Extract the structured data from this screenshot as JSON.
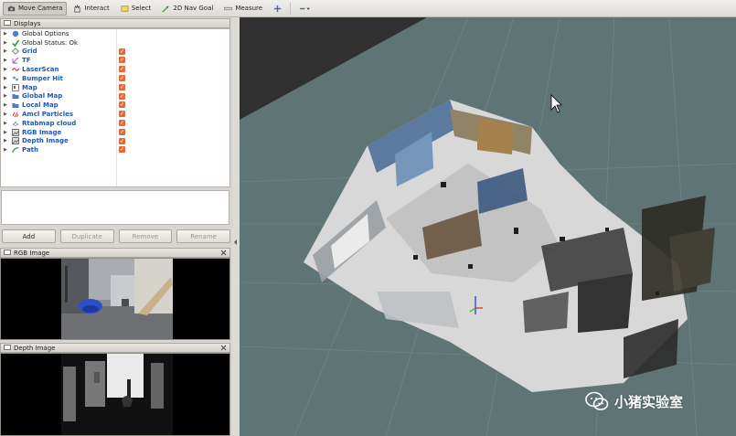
{
  "toolbar": {
    "tools": [
      {
        "label": "Move Camera",
        "active": true,
        "icon": "camera-icon"
      },
      {
        "label": "Interact",
        "active": false,
        "icon": "hand-icon"
      },
      {
        "label": "Select",
        "active": false,
        "icon": "select-icon"
      },
      {
        "label": "2D Nav Goal",
        "active": false,
        "icon": "nav-goal-icon"
      },
      {
        "label": "Measure",
        "active": false,
        "icon": "ruler-icon"
      }
    ],
    "add_icon": "plus-icon",
    "minus_icon": "minus-dropdown-icon"
  },
  "displays_panel": {
    "title": "Displays",
    "items": [
      {
        "label": "Global Options",
        "plain": true,
        "checked": false,
        "icon": "globe-icon",
        "icon_color": "#4a7fd0"
      },
      {
        "label": "Global Status: Ok",
        "plain": true,
        "checked": false,
        "icon": "check-icon",
        "icon_color": "#2c8c2c"
      },
      {
        "label": "Grid",
        "plain": false,
        "checked": true,
        "icon": "grid-icon",
        "icon_color": "#777777"
      },
      {
        "label": "TF",
        "plain": false,
        "checked": true,
        "icon": "tf-icon",
        "icon_color": "#8e5fb8"
      },
      {
        "label": "LaserScan",
        "plain": false,
        "checked": true,
        "icon": "laser-icon",
        "icon_color": "#d03030"
      },
      {
        "label": "Bumper Hit",
        "plain": false,
        "checked": true,
        "icon": "bumper-icon",
        "icon_color": "#5a8fd0"
      },
      {
        "label": "Map",
        "plain": false,
        "checked": true,
        "icon": "map-icon",
        "icon_color": "#666666"
      },
      {
        "label": "Global Map",
        "plain": false,
        "checked": true,
        "icon": "folder-icon",
        "icon_color": "#4b7fc7"
      },
      {
        "label": "Local Map",
        "plain": false,
        "checked": true,
        "icon": "folder-icon",
        "icon_color": "#4b7fc7"
      },
      {
        "label": "Amcl Particles",
        "plain": false,
        "checked": true,
        "icon": "particles-icon",
        "icon_color": "#d04040"
      },
      {
        "label": "Rtabmap cloud",
        "plain": false,
        "checked": true,
        "icon": "cloud-icon",
        "icon_color": "#5a8fd0"
      },
      {
        "label": "RGB Image",
        "plain": false,
        "checked": true,
        "icon": "image-icon",
        "icon_color": "#555555"
      },
      {
        "label": "Depth Image",
        "plain": false,
        "checked": true,
        "icon": "image-icon",
        "icon_color": "#555555"
      },
      {
        "label": "Path",
        "plain": false,
        "checked": true,
        "icon": "path-icon",
        "icon_color": "#2c9c2c"
      }
    ],
    "buttons": [
      {
        "label": "Add",
        "enabled": true
      },
      {
        "label": "Duplicate",
        "enabled": false
      },
      {
        "label": "Remove",
        "enabled": false
      },
      {
        "label": "Rename",
        "enabled": false
      }
    ]
  },
  "rgb_panel": {
    "title": "RGB Image"
  },
  "depth_panel": {
    "title": "Depth Image"
  },
  "watermark": {
    "text": "小猪实验室"
  },
  "colors": {
    "checkbox": "#e36a3a",
    "label_blue": "#1f58b8",
    "floor": "#5f7474",
    "background_3d": "#303030"
  }
}
